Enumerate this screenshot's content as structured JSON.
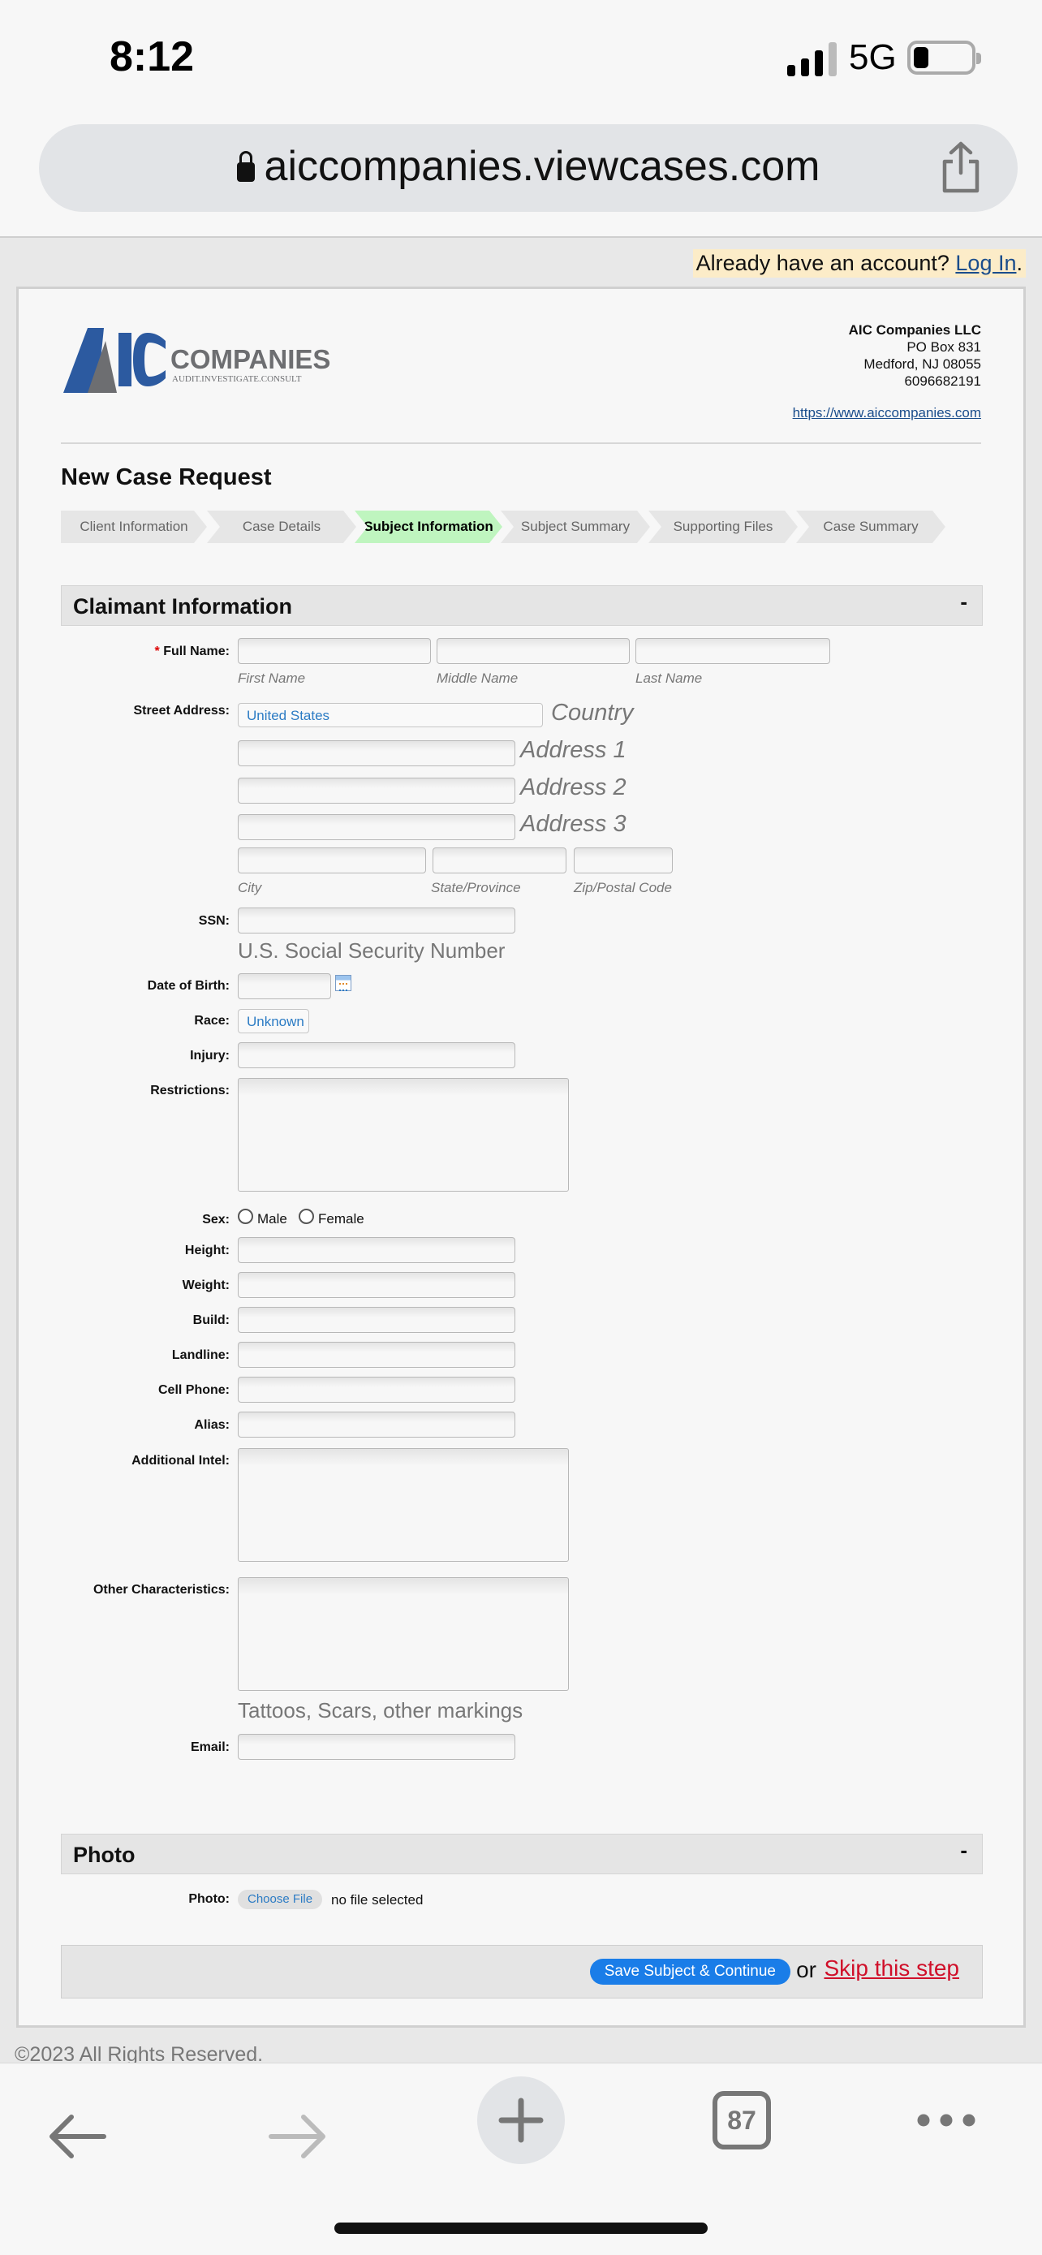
{
  "status_bar": {
    "time": "8:12",
    "network": "5G"
  },
  "browser": {
    "url": "aiccompanies.viewcases.com",
    "tab_count": "87"
  },
  "page": {
    "login_prompt": "Already have an account?",
    "login_link": "Log In",
    "login_period": ".",
    "logo": {
      "letters": "AIC",
      "word": "COMPANIES",
      "tagline": "AUDIT.INVESTIGATE.CONSULT"
    },
    "company": {
      "name": "AIC Companies LLC",
      "address1": "PO Box 831",
      "address2": "Medford, NJ 08055",
      "phone": "6096682191",
      "url": "https://www.aiccompanies.com"
    },
    "title": "New Case Request",
    "steps": [
      "Client Information",
      "Case Details",
      "Subject Information",
      "Subject Summary",
      "Supporting Files",
      "Case Summary"
    ],
    "active_step": "Subject Information",
    "claimant_section": {
      "title": "Claimant Information",
      "toggle": "-"
    },
    "form": {
      "required_mark": "*",
      "full_name_label": "Full Name:",
      "first_name_sub": "First Name",
      "middle_name_sub": "Middle Name",
      "last_name_sub": "Last Name",
      "street_address_label": "Street Address:",
      "country_value": "United States",
      "country_hint": "Country",
      "address1_hint": "Address 1",
      "address2_hint": "Address 2",
      "address3_hint": "Address 3",
      "city_sub": "City",
      "state_sub": "State/Province",
      "zip_sub": "Zip/Postal Code",
      "ssn_label": "SSN:",
      "ssn_hint": "U.S. Social Security Number",
      "dob_label": "Date of Birth:",
      "race_label": "Race:",
      "race_value": "Unknown",
      "injury_label": "Injury:",
      "restrictions_label": "Restrictions:",
      "sex_label": "Sex:",
      "sex_male": "Male",
      "sex_female": "Female",
      "height_label": "Height:",
      "weight_label": "Weight:",
      "build_label": "Build:",
      "landline_label": "Landline:",
      "cell_label": "Cell Phone:",
      "alias_label": "Alias:",
      "intel_label": "Additional Intel:",
      "other_label": "Other Characteristics:",
      "other_hint": "Tattoos, Scars, other markings",
      "email_label": "Email:"
    },
    "photo_section": {
      "title": "Photo",
      "toggle": "-",
      "label": "Photo:",
      "choose_button": "Choose File",
      "no_file": "no file selected"
    },
    "actions": {
      "save": "Save Subject & Continue",
      "or": "or",
      "skip": "Skip this step"
    },
    "copyright": "©2023 All Rights Reserved."
  },
  "colors": {
    "brand_blue": "#2c5aa0",
    "brand_gray": "#6d6e71",
    "active_step": "#bff5bf",
    "save_button": "#1a7de8",
    "skip_link": "#d0102a"
  }
}
